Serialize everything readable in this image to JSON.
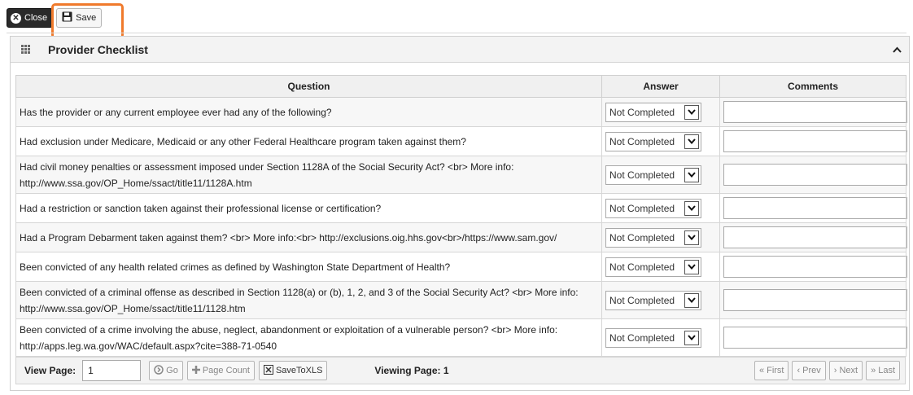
{
  "toolbar": {
    "close_label": "Close",
    "save_label": "Save"
  },
  "panel": {
    "title": "Provider Checklist"
  },
  "table": {
    "headers": {
      "question": "Question",
      "answer": "Answer",
      "comments": "Comments"
    },
    "rows": [
      {
        "question": "Has the provider or any current employee ever had any of the following?",
        "answer": "Not Completed",
        "comment": ""
      },
      {
        "question": "Had exclusion under Medicare, Medicaid or any other Federal Healthcare program taken against them?",
        "answer": "Not Completed",
        "comment": ""
      },
      {
        "question": "Had civil money penalties or assessment imposed under Section 1128A of the Social Security Act? <br> More info: http://www.ssa.gov/OP_Home/ssact/title11/1128A.htm",
        "answer": "Not Completed",
        "comment": ""
      },
      {
        "question": "Had a restriction or sanction taken against their professional license or certification?",
        "answer": "Not Completed",
        "comment": ""
      },
      {
        "question": "Had a Program Debarment taken against them? <br> More info:<br> http://exclusions.oig.hhs.gov<br>/https://www.sam.gov/",
        "answer": "Not Completed",
        "comment": ""
      },
      {
        "question": "Been convicted of any health related crimes as defined by Washington State Department of Health?",
        "answer": "Not Completed",
        "comment": ""
      },
      {
        "question": "Been convicted of a criminal offense as described in Section 1128(a) or (b), 1, 2, and 3 of the Social Security Act? <br> More info: http://www.ssa.gov/OP_Home/ssact/title11/1128.htm",
        "answer": "Not Completed",
        "comment": ""
      },
      {
        "question": "Been convicted of a crime involving the abuse, neglect, abandonment or exploitation of a vulnerable person? <br> More info: http://apps.leg.wa.gov/WAC/default.aspx?cite=388-71-0540",
        "answer": "Not Completed",
        "comment": ""
      }
    ]
  },
  "footer": {
    "view_page_label": "View Page:",
    "view_page_value": "1",
    "go_label": "Go",
    "page_count_label": "Page Count",
    "save_to_xls_label": "SaveToXLS",
    "viewing_page": "Viewing Page: 1",
    "first_label": "First",
    "prev_label": "Prev",
    "next_label": "Next",
    "last_label": "Last"
  },
  "colors": {
    "highlight": "#f07a2c",
    "close_button": "#2a2a2a"
  }
}
